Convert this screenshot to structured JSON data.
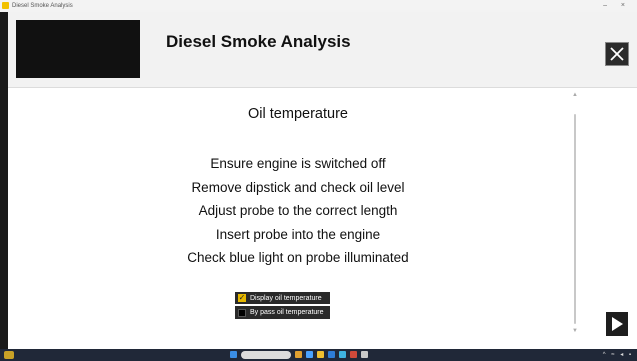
{
  "window": {
    "title": "Diesel Smoke Analysis"
  },
  "header": {
    "heading": "Diesel Smoke Analysis",
    "close_icon": "close-icon"
  },
  "content": {
    "section_title": "Oil temperature",
    "steps": [
      "Ensure engine is switched off",
      "Remove dipstick and check oil level",
      "Adjust probe to the correct length",
      "Insert probe into the engine",
      "Check blue light on probe illuminated"
    ],
    "options": [
      {
        "label": "Display oil temperature",
        "checked": true
      },
      {
        "label": "By pass oil temperature",
        "checked": false
      }
    ],
    "next_icon": "play-next-icon"
  },
  "colors": {
    "accent": "#e6b800",
    "header_bg": "#f2f2f2",
    "dark": "#1e1e1e",
    "taskbar": "#202838"
  }
}
